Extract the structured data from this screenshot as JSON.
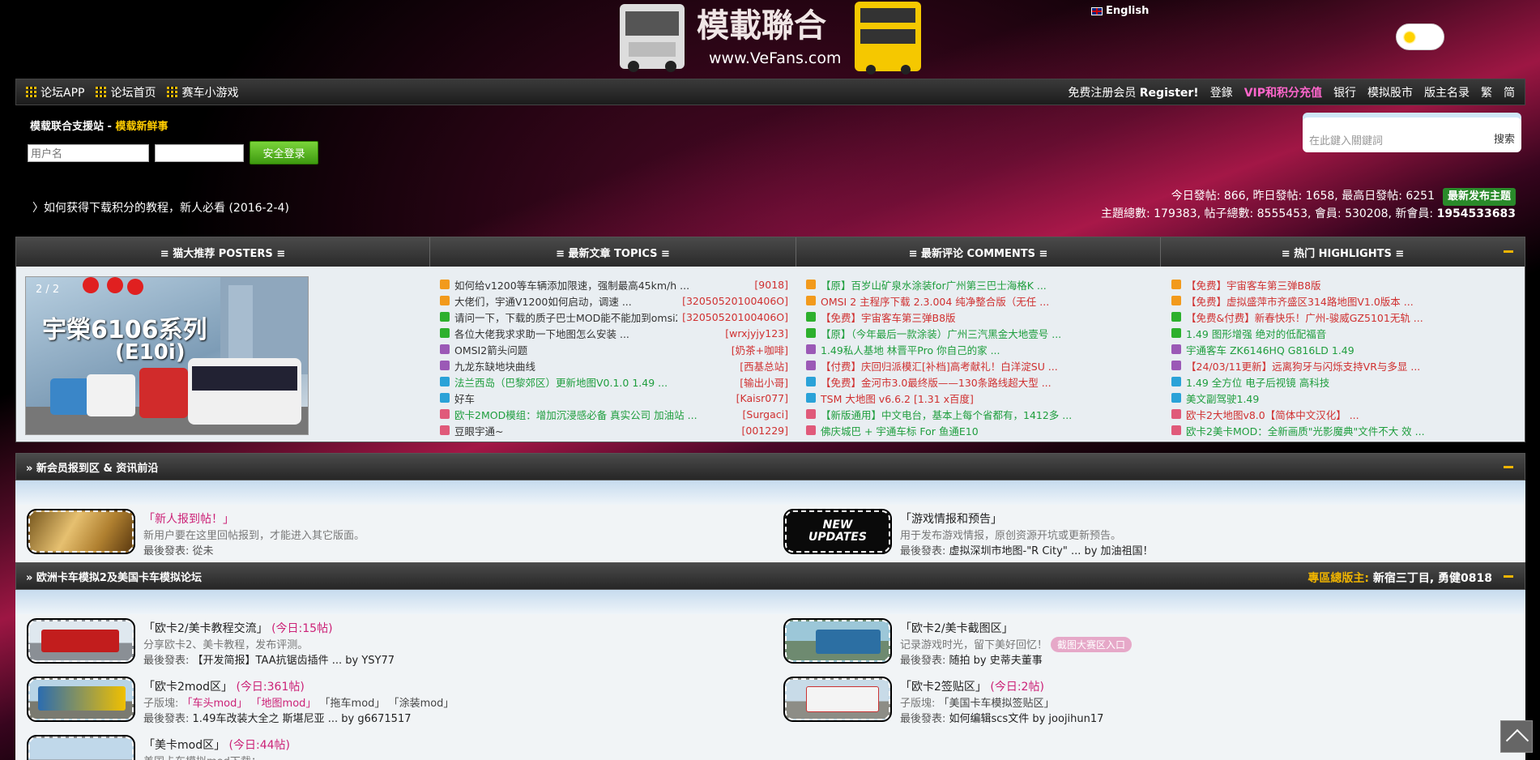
{
  "header": {
    "logo_text": "模載聯合",
    "logo_url": "www.VeFans.com",
    "language": "English"
  },
  "nav": {
    "left": [
      "论坛APP",
      "论坛首页",
      "赛车小游戏"
    ],
    "register_prefix": "免费注册会员",
    "register": "Register!",
    "right": [
      "登錄",
      "VIP和积分充值",
      "银行",
      "模拟股市",
      "版主名录",
      "繁",
      "简"
    ]
  },
  "login": {
    "site": "模载联合支援站",
    "sep": " - ",
    "news": "模载新鲜事",
    "username_placeholder": "用户名",
    "password_placeholder": "",
    "button": "安全登录"
  },
  "search": {
    "placeholder": "在此鍵入關鍵詞",
    "button": "搜索"
  },
  "tip": "〉如何获得下载积分的教程，新人必看 (2016-2-4)",
  "stats": {
    "line1": "今日發帖: 866, 昨日發帖: 1658, 最高日發帖: 6251",
    "new_topic": "最新发布主题",
    "line2_prefix": "主題總數: 179383, 帖子總數: 8555453, 會員: 530208, 新會員: ",
    "line2_member": "1954533683"
  },
  "panel": {
    "headers": [
      "≡ 猫大推荐 POSTERS ≡",
      "≡ 最新文章 TOPICS ≡",
      "≡ 最新评论 COMMENTS ≡",
      "≡ 热门 HIGHLIGHTS ≡"
    ],
    "slide": {
      "counter": "2 / 2",
      "title1": "宇榮6106系列",
      "title2": "(E10i)"
    },
    "topics": [
      {
        "t": "如何给v1200等车辆添加限速，强制最高45km/h ...",
        "a": "[9018]",
        "c": "#f29a1c"
      },
      {
        "t": "大佬们，宇通V1200如何启动，调速 ...",
        "a": "[32050520100406O]",
        "c": "#f29a1c"
      },
      {
        "t": "请问一下，下载的质子巴士MOD能不能加到omsi2里",
        "a": "[32050520100406O]",
        "c": "#2db02d"
      },
      {
        "t": "各位大佬我求求助一下地图怎么安装 ...",
        "a": "[wrxjyjy123]",
        "c": "#2db02d"
      },
      {
        "t": "OMSI2箭头问题",
        "a": "[奶茶+咖啡]",
        "c": "#9b59b6"
      },
      {
        "t": "九龙东缺地块曲线",
        "a": "[西基总站]",
        "c": "#9b59b6"
      },
      {
        "t": "法兰西岛（巴黎郊区）更新地图V0.1.0 1.49 ...",
        "a": "[输出小哥]",
        "c": "#2aa2d8",
        "cls": "g"
      },
      {
        "t": "好车",
        "a": "[Kaisr077]",
        "c": "#2aa2d8"
      },
      {
        "t": "欧卡2MOD模组：增加沉浸感必备 真实公司 加油站 ...",
        "a": "[Surgaci]",
        "c": "#e05a7a",
        "cls": "g"
      },
      {
        "t": "豆眼宇通~",
        "a": "[001229]",
        "c": "#e05a7a"
      }
    ],
    "comments": [
      {
        "t": "【原】百岁山矿泉水涂装for广州第三巴士海格K ...",
        "c": "#f29a1c",
        "cls": "g"
      },
      {
        "t": "OMSI 2 主程序下载 2.3.004 纯净整合版（无任 ...",
        "c": "#f29a1c",
        "cls": "r"
      },
      {
        "t": "【免费】宇宙客车第三弹B8版",
        "c": "#2db02d",
        "cls": "r"
      },
      {
        "t": "【原】（今年最后一款涂装）广州三汽黑金大地壹号 ...",
        "c": "#2db02d",
        "cls": "g"
      },
      {
        "t": "1.49私人基地 林晋平Pro 你自己的家 ...",
        "c": "#9b59b6",
        "cls": "g"
      },
      {
        "t": "【付费】庆回归派模汇[补档]高考献礼！白洋淀SU ...",
        "c": "#9b59b6",
        "cls": "r"
      },
      {
        "t": "【免费】金河市3.0最终版——130条路线超大型 ...",
        "c": "#2aa2d8",
        "cls": "r"
      },
      {
        "t": "TSM 大地图 v6.6.2 [1.31 x百度]",
        "c": "#2aa2d8",
        "cls": "r"
      },
      {
        "t": "【新版通用】中文电台，基本上每个省都有，1412多 ...",
        "c": "#e05a7a",
        "cls": "g"
      },
      {
        "t": "佛庆城巴 + 宇通车标 For 鱼通E10",
        "c": "#e05a7a",
        "cls": "g"
      }
    ],
    "highlights": [
      {
        "t": "【免费】宇宙客车第三弹B8版",
        "c": "#f29a1c",
        "cls": "r"
      },
      {
        "t": "【免费】虚拟盛萍市齐盛区314路地图V1.0版本 ...",
        "c": "#f29a1c",
        "cls": "r"
      },
      {
        "t": "【免费&付费】新春快乐！广州-骏威GZ5101无轨 ...",
        "c": "#2db02d",
        "cls": "r"
      },
      {
        "t": "1.49 图形增强 绝对的低配福音",
        "c": "#2db02d",
        "cls": "g"
      },
      {
        "t": "宇通客车 ZK6146HQ G816LD 1.49",
        "c": "#9b59b6",
        "cls": "g"
      },
      {
        "t": "【24/03/11更新】远离狗牙与闪烁支持VR与多显 ...",
        "c": "#9b59b6",
        "cls": "r"
      },
      {
        "t": "1.49 全方位 电子后视镜 高科技",
        "c": "#2aa2d8",
        "cls": "g"
      },
      {
        "t": "美文副驾驶1.49",
        "c": "#2aa2d8",
        "cls": "g"
      },
      {
        "t": "欧卡2大地图v8.0【简体中文汉化】 ...",
        "c": "#e05a7a",
        "cls": "r"
      },
      {
        "t": "欧卡2美卡MOD：全新画质\"光影魔典\"文件不大 效 ...",
        "c": "#e05a7a",
        "cls": "g"
      }
    ]
  },
  "section1": {
    "title": "» 新会员报到区 & 资讯前沿",
    "f1": {
      "name": "「新人报到帖！」",
      "desc": "新用户要在这里回帖报到，才能进入其它版面。",
      "last_label": "最後發表: ",
      "last": "從未"
    },
    "f2": {
      "name": "「游戏情报和预告」",
      "desc": "用于发布游戏情报，原创资源开坑或更新预告。",
      "last_label": "最後發表: ",
      "last": "虚拟深圳市地图-\"R City\" ... by 加油祖国！",
      "img_text1": "NEW",
      "img_text2": "UPDATES"
    }
  },
  "section2": {
    "title": "» 欧洲卡车模拟2及美国卡车模拟论坛",
    "mod_label": "專區總版主:",
    "mod": " 新宿三丁目, 勇健0818",
    "f1": {
      "name": "「欧卡2/美卡教程交流」",
      "today": "(今日:15帖)",
      "desc": "分享欧卡2、美卡教程，发布评测。",
      "last_label": "最後發表: ",
      "last": "【开发简报】TAA抗锯齿插件 ... by YSY77"
    },
    "f2": {
      "name": "「欧卡2/美卡截图区」",
      "desc": "记录游戏时光，留下美好回忆！",
      "tag": "截图大赛区入口",
      "last_label": "最後發表: ",
      "last": "随拍 by 史蒂夫董事"
    },
    "f3": {
      "name": "「欧卡2mod区」",
      "today": "(今日:361帖)",
      "sub_label": "子版塊: ",
      "sub1": "「车头mod」",
      "sub2": "「地图mod」",
      "sub3": "「拖车mod」",
      "sub4": "「涂装mod」",
      "last_label": "最後發表: ",
      "last": "1.49车改装大全之 斯堪尼亚 ... by g6671517"
    },
    "f4": {
      "name": "「欧卡2签贴区」",
      "today": "(今日:2帖)",
      "sub_label": "子版塊: ",
      "sub1": "「美国卡车模拟签贴区」",
      "last_label": "最後發表: ",
      "last": "如何编辑scs文件 by joojihun17"
    },
    "f5": {
      "name": "「美卡mod区」",
      "today": "(今日:44帖)",
      "desc": "美国卡车模拟mod下载："
    }
  }
}
